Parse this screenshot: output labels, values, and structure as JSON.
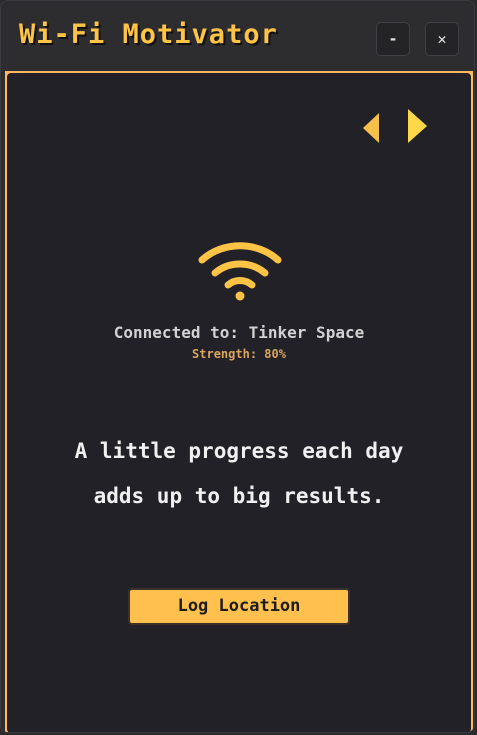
{
  "window": {
    "title": "Wi-Fi Motivator",
    "minimize_label": "-",
    "close_label": "✕"
  },
  "navigation": {
    "prev_icon": "triangle-left-icon",
    "next_icon": "triangle-right-icon"
  },
  "status": {
    "icon": "wifi-icon",
    "connected_text": "Connected to: Tinker Space",
    "strength_text": "Strength: 80%"
  },
  "quote": {
    "line1": "A little progress each day",
    "line2": "adds up to big results."
  },
  "actions": {
    "log_location_label": "Log Location"
  },
  "colors": {
    "accent": "#ffc04d",
    "panel_background": "#212127",
    "border": "#ffb760"
  }
}
